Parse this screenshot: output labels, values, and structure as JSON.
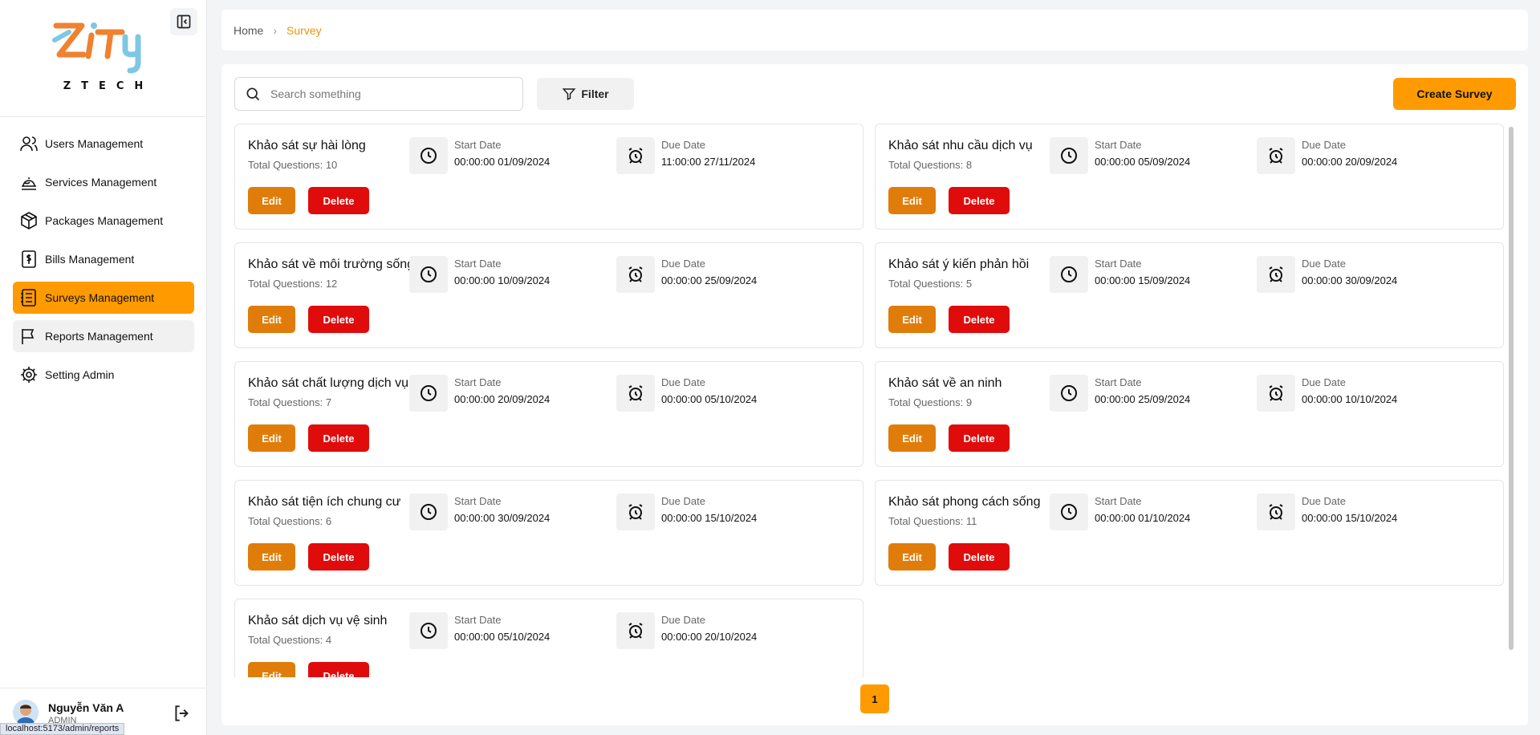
{
  "brand": {
    "logo_text": "ZTECH",
    "logo_icon": "zity-logo"
  },
  "sidebar": {
    "collapse_icon": "sidebar-collapse-icon",
    "items": [
      {
        "label": "Users Management",
        "icon": "users-icon"
      },
      {
        "label": "Services Management",
        "icon": "service-bell-icon"
      },
      {
        "label": "Packages Management",
        "icon": "package-icon"
      },
      {
        "label": "Bills Management",
        "icon": "bill-icon"
      },
      {
        "label": "Surveys Management",
        "icon": "survey-icon",
        "active": true
      },
      {
        "label": "Reports Management",
        "icon": "flag-icon"
      },
      {
        "label": "Setting Admin",
        "icon": "settings-icon"
      }
    ],
    "user": {
      "name": "Nguyễn Văn A",
      "role": "ADMIN"
    },
    "logout_icon": "logout-icon"
  },
  "status_bar": {
    "url": "localhost:5173/admin/reports"
  },
  "breadcrumb": {
    "home": "Home",
    "current": "Survey"
  },
  "toolbar": {
    "search_placeholder": "Search something",
    "filter_label": "Filter",
    "create_label": "Create Survey"
  },
  "labels": {
    "start_date": "Start Date",
    "due_date": "Due Date",
    "edit": "Edit",
    "delete": "Delete"
  },
  "surveys": [
    {
      "title": "Khảo sát sự hài lòng",
      "total": "Total Questions: 10",
      "start": "00:00:00 01/09/2024",
      "due": "11:00:00 27/11/2024"
    },
    {
      "title": "Khảo sát nhu cầu dịch vụ",
      "total": "Total Questions: 8",
      "start": "00:00:00 05/09/2024",
      "due": "00:00:00 20/09/2024"
    },
    {
      "title": "Khảo sát về môi trường sống",
      "total": "Total Questions: 12",
      "start": "00:00:00 10/09/2024",
      "due": "00:00:00 25/09/2024"
    },
    {
      "title": "Khảo sát ý kiến phản hồi",
      "total": "Total Questions: 5",
      "start": "00:00:00 15/09/2024",
      "due": "00:00:00 30/09/2024"
    },
    {
      "title": "Khảo sát chất lượng dịch vụ",
      "total": "Total Questions: 7",
      "start": "00:00:00 20/09/2024",
      "due": "00:00:00 05/10/2024"
    },
    {
      "title": "Khảo sát về an ninh",
      "total": "Total Questions: 9",
      "start": "00:00:00 25/09/2024",
      "due": "00:00:00 10/10/2024"
    },
    {
      "title": "Khảo sát tiện ích chung cư",
      "total": "Total Questions: 6",
      "start": "00:00:00 30/09/2024",
      "due": "00:00:00 15/10/2024"
    },
    {
      "title": "Khảo sát phong cách sống",
      "total": "Total Questions: 11",
      "start": "00:00:00 01/10/2024",
      "due": "00:00:00 15/10/2024"
    },
    {
      "title": "Khảo sát dịch vụ vệ sinh",
      "total": "Total Questions: 4",
      "start": "00:00:00 05/10/2024",
      "due": "00:00:00 20/10/2024"
    }
  ],
  "pagination": {
    "current": "1"
  },
  "colors": {
    "accent": "#ff9b00",
    "edit": "#e07d0a",
    "delete": "#e00c0c"
  }
}
